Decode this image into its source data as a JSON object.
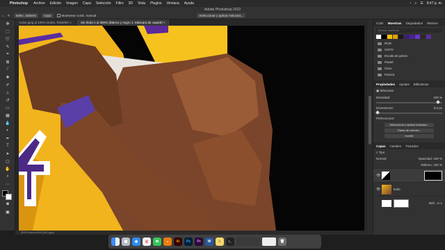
{
  "menubar": {
    "apple": "",
    "app": "Photoshop",
    "items": [
      "Archivo",
      "Edición",
      "Imagen",
      "Capa",
      "Selección",
      "Filtro",
      "3D",
      "Vista",
      "Plugins",
      "Ventana",
      "Ayuda"
    ],
    "clock": "8:47 p. m."
  },
  "window_title": "Adobe Photoshop 2022",
  "options": {
    "select_subject": "Selec. asistent",
    "layer_label": "Capa",
    "sample_all": "Muestrear comb. manual",
    "refine": "Seleccionar y aplicar máscara..."
  },
  "tabs": [
    {
      "label": "Kobe.jpeg al 100% (Kobe, RGB/8#)",
      "active": false
    },
    {
      "label": "Sin título-1 al 300% (Blanco y negro 1, Máscara de capa/8)",
      "active": true
    }
  ],
  "status": "300%   Arena 918 (300 ppp)",
  "panel_swatches": {
    "tabs": [
      "Color",
      "Muestras",
      "Degradados",
      "Motivos"
    ],
    "active_tab": "Muestras",
    "search_placeholder": "Buscar muestras",
    "colors": [
      "#ffffff",
      "#000000",
      "#f5c400",
      "#e2a200",
      "#1a1a1a",
      "#3d1f6e",
      "#4b1f9c",
      "#6a36c8",
      "#2a2a2a",
      "#5a2da0"
    ],
    "folders": [
      "RGB",
      "CMYK",
      "Escala de grises",
      "Pastel",
      "Claro",
      "Pureza"
    ]
  },
  "panel_properties": {
    "tabs": [
      "Propiedades",
      "Ajustes",
      "Bibliotecas"
    ],
    "active_tab": "Propiedades",
    "subtitle": "Máscaras",
    "density_label": "Densidad:",
    "density_value": "100 %",
    "feather_label": "Desvanecer:",
    "feather_value": "0,0 px",
    "refine_label": "Perfeccionar:",
    "btn_select_mask": "Seleccionar y aplicar máscara...",
    "btn_color_range": "Gama de colores...",
    "btn_invert": "Invertir"
  },
  "panel_layers": {
    "tabs": [
      "Capas",
      "Canales",
      "Trazados"
    ],
    "active_tab": "Capas",
    "kind_label": "Tipo",
    "blend_mode": "Normal",
    "opacity_label": "Opacidad:",
    "opacity_value": "100 %",
    "fill_label": "Relleno:",
    "fill_value": "100 %",
    "layers": [
      {
        "name": "",
        "visible": true
      },
      {
        "name": "kobe",
        "visible": true
      },
      {
        "name": "Bell.. or 1",
        "visible": false
      }
    ]
  },
  "dock": [
    "Finder",
    "Launchpad",
    "Safari",
    "Chrome",
    "Mensajes",
    "Blender",
    "Illustrator",
    "Photoshop",
    "Premiere",
    "Word",
    "Notas",
    "Terminal",
    "Papelera"
  ]
}
